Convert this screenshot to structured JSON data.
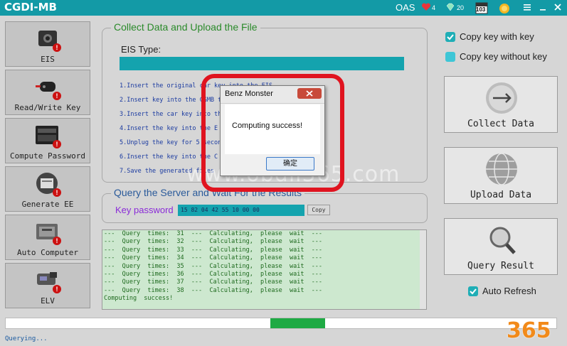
{
  "titlebar": {
    "title": "CGDI-MB",
    "oas": "OAS",
    "hearts": "4",
    "gems": "20",
    "calendar": "103",
    "menu_icon": "hamburger-icon",
    "minimize_icon": "minimize-icon",
    "close_icon": "close-icon"
  },
  "sidebar": {
    "items": [
      {
        "label": "EIS",
        "icon": "eis-module-icon"
      },
      {
        "label": "Read/Write Key",
        "icon": "car-key-icon"
      },
      {
        "label": "Compute Password",
        "icon": "keyboard-icon"
      },
      {
        "label": "Generate EE",
        "icon": "printer-icon"
      },
      {
        "label": "Auto Computer",
        "icon": "ecu-icon"
      },
      {
        "label": "ELV",
        "icon": "steering-lock-icon"
      }
    ],
    "badge": "!"
  },
  "collect": {
    "title": "Collect Data and Upload the File",
    "eis_type_label": "EIS Type:",
    "steps": [
      "1.Insert  the  original  car  key  into  the  EIS",
      "2.Insert  key  into  the  CGMB  then  click  connection",
      "3.Insert  the  car  key  into  the",
      "4.Insert  the  key  into  the  E",
      "5.Unplug  the  key  for  5  seconds  then  into  EIS",
      "6.Insert  the  key  into  the  C",
      "7.Save  the  generated  files"
    ]
  },
  "query": {
    "title": "Query the Server and Wait For the Results",
    "key_password_label": "Key password",
    "key_password_value": "15 82 04 42 55 10 00 00",
    "copy_label": "Copy"
  },
  "log": {
    "lines": [
      "---  Query  times:  31  ---  Calculating,  please  wait  ---",
      "---  Query  times:  32  ---  Calculating,  please  wait  ---",
      "---  Query  times:  33  ---  Calculating,  please  wait  ---",
      "---  Query  times:  34  ---  Calculating,  please  wait  ---",
      "---  Query  times:  35  ---  Calculating,  please  wait  ---",
      "---  Query  times:  36  ---  Calculating,  please  wait  ---",
      "---  Query  times:  37  ---  Calculating,  please  wait  ---",
      "---  Query  times:  38  ---  Calculating,  please  wait  ---",
      "Computing  success!"
    ]
  },
  "right": {
    "copy_with_key": "Copy key with key",
    "copy_without_key": "Copy key without key",
    "copy_with_key_checked": true,
    "copy_without_key_checked": false,
    "collect_data": "Collect Data",
    "upload_data": "Upload  Data",
    "query_result": "Query Result",
    "auto_refresh": "Auto Refresh",
    "auto_refresh_checked": true
  },
  "progress": {
    "segment_start": 0.48,
    "segment_end": 0.58,
    "color": "#1faa44"
  },
  "status": {
    "text": "Querying..."
  },
  "dialog": {
    "title": "Benz Monster",
    "message": "Computing success!",
    "ok_label": "确定",
    "close_icon": "close-icon"
  },
  "watermark": {
    "text": "www.obdii365.com",
    "logo": "365"
  },
  "colors": {
    "titlebar": "#139aa6",
    "accent": "#14a3ae",
    "panel_title": "#2a8a2a",
    "highlight_border": "#e0131f"
  }
}
